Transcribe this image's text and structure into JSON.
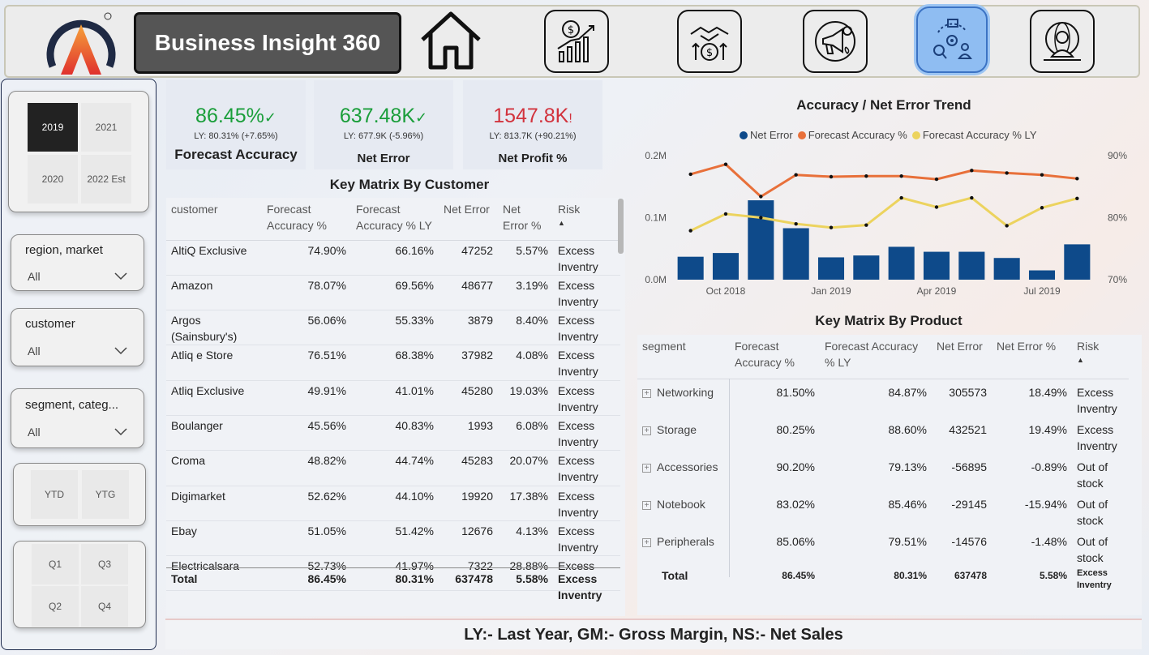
{
  "header": {
    "app_title": "Business Insight 360",
    "nav": [
      {
        "icon": "home-icon"
      },
      {
        "icon": "finance-chart-icon"
      },
      {
        "icon": "sales-handshake-icon"
      },
      {
        "icon": "marketing-megaphone-icon"
      },
      {
        "icon": "supply-chain-icon",
        "active": true
      },
      {
        "icon": "executive-globe-icon"
      }
    ]
  },
  "filters": {
    "years": [
      "2019",
      "2021",
      "2020",
      "2022 Est"
    ],
    "selected_year": "2019",
    "region_market": {
      "label": "region, market",
      "value": "All"
    },
    "customer": {
      "label": "customer",
      "value": "All"
    },
    "segment_category": {
      "label": "segment, categ...",
      "value": "All"
    },
    "period": [
      "YTD",
      "YTG"
    ],
    "quarters": [
      "Q1",
      "Q3",
      "Q2",
      "Q4"
    ]
  },
  "kpis": [
    {
      "value": "86.45%",
      "mark": "✓",
      "status": "good",
      "ly": "LY: 80.31% (+7.65%)",
      "label": "Forecast Accuracy"
    },
    {
      "value": "637.48K",
      "mark": "✓",
      "status": "good",
      "ly": "LY: 677.9K (-5.96%)",
      "label": "Net Error"
    },
    {
      "value": "1547.8K",
      "mark": "!",
      "status": "bad",
      "ly": "LY: 813.7K (+90.21%)",
      "label": "Net Profit %"
    }
  ],
  "customer_table": {
    "title": "Key Matrix By Customer",
    "columns": [
      "customer",
      "Forecast Accuracy %",
      "Forecast Accuracy % LY",
      "Net Error",
      "Net Error %",
      "Risk"
    ],
    "rows": [
      [
        "AltiQ Exclusive",
        "74.90%",
        "66.16%",
        "47252",
        "5.57%",
        "Excess Inventry"
      ],
      [
        "Amazon",
        "78.07%",
        "69.56%",
        "48677",
        "3.19%",
        "Excess Inventry"
      ],
      [
        "Argos (Sainsbury's)",
        "56.06%",
        "55.33%",
        "3879",
        "8.40%",
        "Excess Inventry"
      ],
      [
        "Atliq e Store",
        "76.51%",
        "68.38%",
        "37982",
        "4.08%",
        "Excess Inventry"
      ],
      [
        "Atliq Exclusive",
        "49.91%",
        "41.01%",
        "45280",
        "19.03%",
        "Excess Inventry"
      ],
      [
        "Boulanger",
        "45.56%",
        "40.83%",
        "1993",
        "6.08%",
        "Excess Inventry"
      ],
      [
        "Croma",
        "48.82%",
        "44.74%",
        "45283",
        "20.07%",
        "Excess Inventry"
      ],
      [
        "Digimarket",
        "52.62%",
        "44.10%",
        "19920",
        "17.38%",
        "Excess Inventry"
      ],
      [
        "Ebay",
        "51.05%",
        "51.42%",
        "12676",
        "4.13%",
        "Excess Inventry"
      ],
      [
        "Electricalsara",
        "52.73%",
        "41.97%",
        "7322",
        "28.88%",
        "Excess"
      ]
    ],
    "total": [
      "Total",
      "86.45%",
      "80.31%",
      "637478",
      "5.58%",
      "Excess Inventry"
    ]
  },
  "chart_data": {
    "type": "bar",
    "title": "Accuracy / Net Error Trend",
    "x_ticks": [
      "Oct 2018",
      "Jan 2019",
      "Apr 2019",
      "Jul 2019"
    ],
    "categories": [
      "Sep 2018",
      "Oct 2018",
      "Nov 2018",
      "Dec 2018",
      "Jan 2019",
      "Feb 2019",
      "Mar 2019",
      "Apr 2019",
      "May 2019",
      "Jun 2019",
      "Jul 2019",
      "Aug 2019"
    ],
    "y_left_ticks": [
      "0.0M",
      "0.1M",
      "0.2M"
    ],
    "y_right_ticks": [
      "70%",
      "80%",
      "90%"
    ],
    "ylim_left": [
      0,
      0.2
    ],
    "ylim_right": [
      70,
      90
    ],
    "series": [
      {
        "name": "Net Error",
        "kind": "bar",
        "color": "#0e4a8a",
        "values": [
          0.037,
          0.043,
          0.128,
          0.083,
          0.036,
          0.039,
          0.053,
          0.045,
          0.045,
          0.035,
          0.015,
          0.057
        ]
      },
      {
        "name": "Forecast Accuracy %",
        "kind": "line",
        "color": "#e8703a",
        "values": [
          87.0,
          88.6,
          83.4,
          86.9,
          86.6,
          86.7,
          86.7,
          86.2,
          87.6,
          87.2,
          86.9,
          86.3
        ]
      },
      {
        "name": "Forecast Accuracy % LY",
        "kind": "line",
        "color": "#ecd35e",
        "values": [
          77.9,
          80.6,
          80.0,
          79.0,
          78.4,
          78.8,
          83.2,
          81.7,
          83.2,
          78.7,
          81.6,
          83.1
        ]
      }
    ],
    "legend": "top"
  },
  "product_table": {
    "title": "Key Matrix By Product",
    "columns": [
      "segment",
      "Forecast Accuracy %",
      "Forecast Accuracy % LY",
      "Net Error",
      "Net Error %",
      "Risk"
    ],
    "rows": [
      [
        "Networking",
        "81.50%",
        "84.87%",
        "305573",
        "18.49%",
        "Excess Inventry"
      ],
      [
        "Storage",
        "80.25%",
        "88.60%",
        "432521",
        "19.49%",
        "Excess Inventry"
      ],
      [
        "Accessories",
        "90.20%",
        "79.13%",
        "-56895",
        "-0.89%",
        "Out of stock"
      ],
      [
        "Notebook",
        "83.02%",
        "85.46%",
        "-29145",
        "-15.94%",
        "Out of stock"
      ],
      [
        "Peripherals",
        "85.06%",
        "79.51%",
        "-14576",
        "-1.48%",
        "Out of stock"
      ]
    ],
    "total": [
      "Total",
      "86.45%",
      "80.31%",
      "637478",
      "5.58%",
      "Excess Inventry"
    ]
  },
  "footer": {
    "text": "LY:- Last Year,  GM:- Gross Margin, NS:- Net Sales"
  },
  "colors": {
    "good": "#1a9e3a",
    "bad": "#d2333d",
    "accent": "#8fbdf2"
  }
}
